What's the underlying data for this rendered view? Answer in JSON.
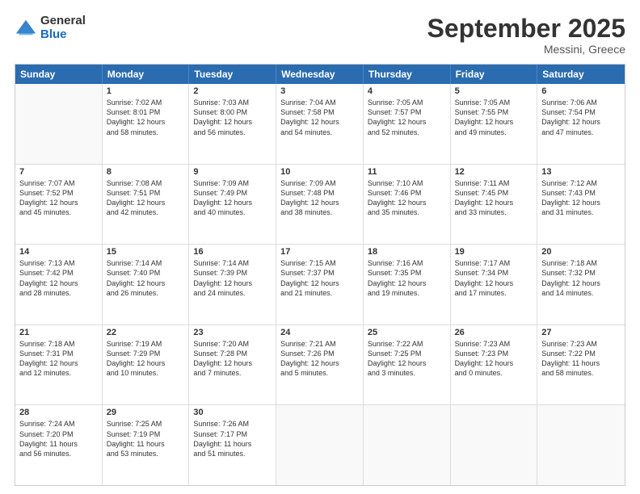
{
  "logo": {
    "general": "General",
    "blue": "Blue"
  },
  "title": "September 2025",
  "location": "Messini, Greece",
  "days": [
    "Sunday",
    "Monday",
    "Tuesday",
    "Wednesday",
    "Thursday",
    "Friday",
    "Saturday"
  ],
  "weeks": [
    [
      {
        "day": "",
        "empty": true
      },
      {
        "day": "1",
        "lines": [
          "Sunrise: 7:02 AM",
          "Sunset: 8:01 PM",
          "Daylight: 12 hours",
          "and 58 minutes."
        ]
      },
      {
        "day": "2",
        "lines": [
          "Sunrise: 7:03 AM",
          "Sunset: 8:00 PM",
          "Daylight: 12 hours",
          "and 56 minutes."
        ]
      },
      {
        "day": "3",
        "lines": [
          "Sunrise: 7:04 AM",
          "Sunset: 7:58 PM",
          "Daylight: 12 hours",
          "and 54 minutes."
        ]
      },
      {
        "day": "4",
        "lines": [
          "Sunrise: 7:05 AM",
          "Sunset: 7:57 PM",
          "Daylight: 12 hours",
          "and 52 minutes."
        ]
      },
      {
        "day": "5",
        "lines": [
          "Sunrise: 7:05 AM",
          "Sunset: 7:55 PM",
          "Daylight: 12 hours",
          "and 49 minutes."
        ]
      },
      {
        "day": "6",
        "lines": [
          "Sunrise: 7:06 AM",
          "Sunset: 7:54 PM",
          "Daylight: 12 hours",
          "and 47 minutes."
        ]
      }
    ],
    [
      {
        "day": "7",
        "lines": [
          "Sunrise: 7:07 AM",
          "Sunset: 7:52 PM",
          "Daylight: 12 hours",
          "and 45 minutes."
        ]
      },
      {
        "day": "8",
        "lines": [
          "Sunrise: 7:08 AM",
          "Sunset: 7:51 PM",
          "Daylight: 12 hours",
          "and 42 minutes."
        ]
      },
      {
        "day": "9",
        "lines": [
          "Sunrise: 7:09 AM",
          "Sunset: 7:49 PM",
          "Daylight: 12 hours",
          "and 40 minutes."
        ]
      },
      {
        "day": "10",
        "lines": [
          "Sunrise: 7:09 AM",
          "Sunset: 7:48 PM",
          "Daylight: 12 hours",
          "and 38 minutes."
        ]
      },
      {
        "day": "11",
        "lines": [
          "Sunrise: 7:10 AM",
          "Sunset: 7:46 PM",
          "Daylight: 12 hours",
          "and 35 minutes."
        ]
      },
      {
        "day": "12",
        "lines": [
          "Sunrise: 7:11 AM",
          "Sunset: 7:45 PM",
          "Daylight: 12 hours",
          "and 33 minutes."
        ]
      },
      {
        "day": "13",
        "lines": [
          "Sunrise: 7:12 AM",
          "Sunset: 7:43 PM",
          "Daylight: 12 hours",
          "and 31 minutes."
        ]
      }
    ],
    [
      {
        "day": "14",
        "lines": [
          "Sunrise: 7:13 AM",
          "Sunset: 7:42 PM",
          "Daylight: 12 hours",
          "and 28 minutes."
        ]
      },
      {
        "day": "15",
        "lines": [
          "Sunrise: 7:14 AM",
          "Sunset: 7:40 PM",
          "Daylight: 12 hours",
          "and 26 minutes."
        ]
      },
      {
        "day": "16",
        "lines": [
          "Sunrise: 7:14 AM",
          "Sunset: 7:39 PM",
          "Daylight: 12 hours",
          "and 24 minutes."
        ]
      },
      {
        "day": "17",
        "lines": [
          "Sunrise: 7:15 AM",
          "Sunset: 7:37 PM",
          "Daylight: 12 hours",
          "and 21 minutes."
        ]
      },
      {
        "day": "18",
        "lines": [
          "Sunrise: 7:16 AM",
          "Sunset: 7:35 PM",
          "Daylight: 12 hours",
          "and 19 minutes."
        ]
      },
      {
        "day": "19",
        "lines": [
          "Sunrise: 7:17 AM",
          "Sunset: 7:34 PM",
          "Daylight: 12 hours",
          "and 17 minutes."
        ]
      },
      {
        "day": "20",
        "lines": [
          "Sunrise: 7:18 AM",
          "Sunset: 7:32 PM",
          "Daylight: 12 hours",
          "and 14 minutes."
        ]
      }
    ],
    [
      {
        "day": "21",
        "lines": [
          "Sunrise: 7:18 AM",
          "Sunset: 7:31 PM",
          "Daylight: 12 hours",
          "and 12 minutes."
        ]
      },
      {
        "day": "22",
        "lines": [
          "Sunrise: 7:19 AM",
          "Sunset: 7:29 PM",
          "Daylight: 12 hours",
          "and 10 minutes."
        ]
      },
      {
        "day": "23",
        "lines": [
          "Sunrise: 7:20 AM",
          "Sunset: 7:28 PM",
          "Daylight: 12 hours",
          "and 7 minutes."
        ]
      },
      {
        "day": "24",
        "lines": [
          "Sunrise: 7:21 AM",
          "Sunset: 7:26 PM",
          "Daylight: 12 hours",
          "and 5 minutes."
        ]
      },
      {
        "day": "25",
        "lines": [
          "Sunrise: 7:22 AM",
          "Sunset: 7:25 PM",
          "Daylight: 12 hours",
          "and 3 minutes."
        ]
      },
      {
        "day": "26",
        "lines": [
          "Sunrise: 7:23 AM",
          "Sunset: 7:23 PM",
          "Daylight: 12 hours",
          "and 0 minutes."
        ]
      },
      {
        "day": "27",
        "lines": [
          "Sunrise: 7:23 AM",
          "Sunset: 7:22 PM",
          "Daylight: 11 hours",
          "and 58 minutes."
        ]
      }
    ],
    [
      {
        "day": "28",
        "lines": [
          "Sunrise: 7:24 AM",
          "Sunset: 7:20 PM",
          "Daylight: 11 hours",
          "and 56 minutes."
        ]
      },
      {
        "day": "29",
        "lines": [
          "Sunrise: 7:25 AM",
          "Sunset: 7:19 PM",
          "Daylight: 11 hours",
          "and 53 minutes."
        ]
      },
      {
        "day": "30",
        "lines": [
          "Sunrise: 7:26 AM",
          "Sunset: 7:17 PM",
          "Daylight: 11 hours",
          "and 51 minutes."
        ]
      },
      {
        "day": "",
        "empty": true
      },
      {
        "day": "",
        "empty": true
      },
      {
        "day": "",
        "empty": true
      },
      {
        "day": "",
        "empty": true
      }
    ]
  ]
}
